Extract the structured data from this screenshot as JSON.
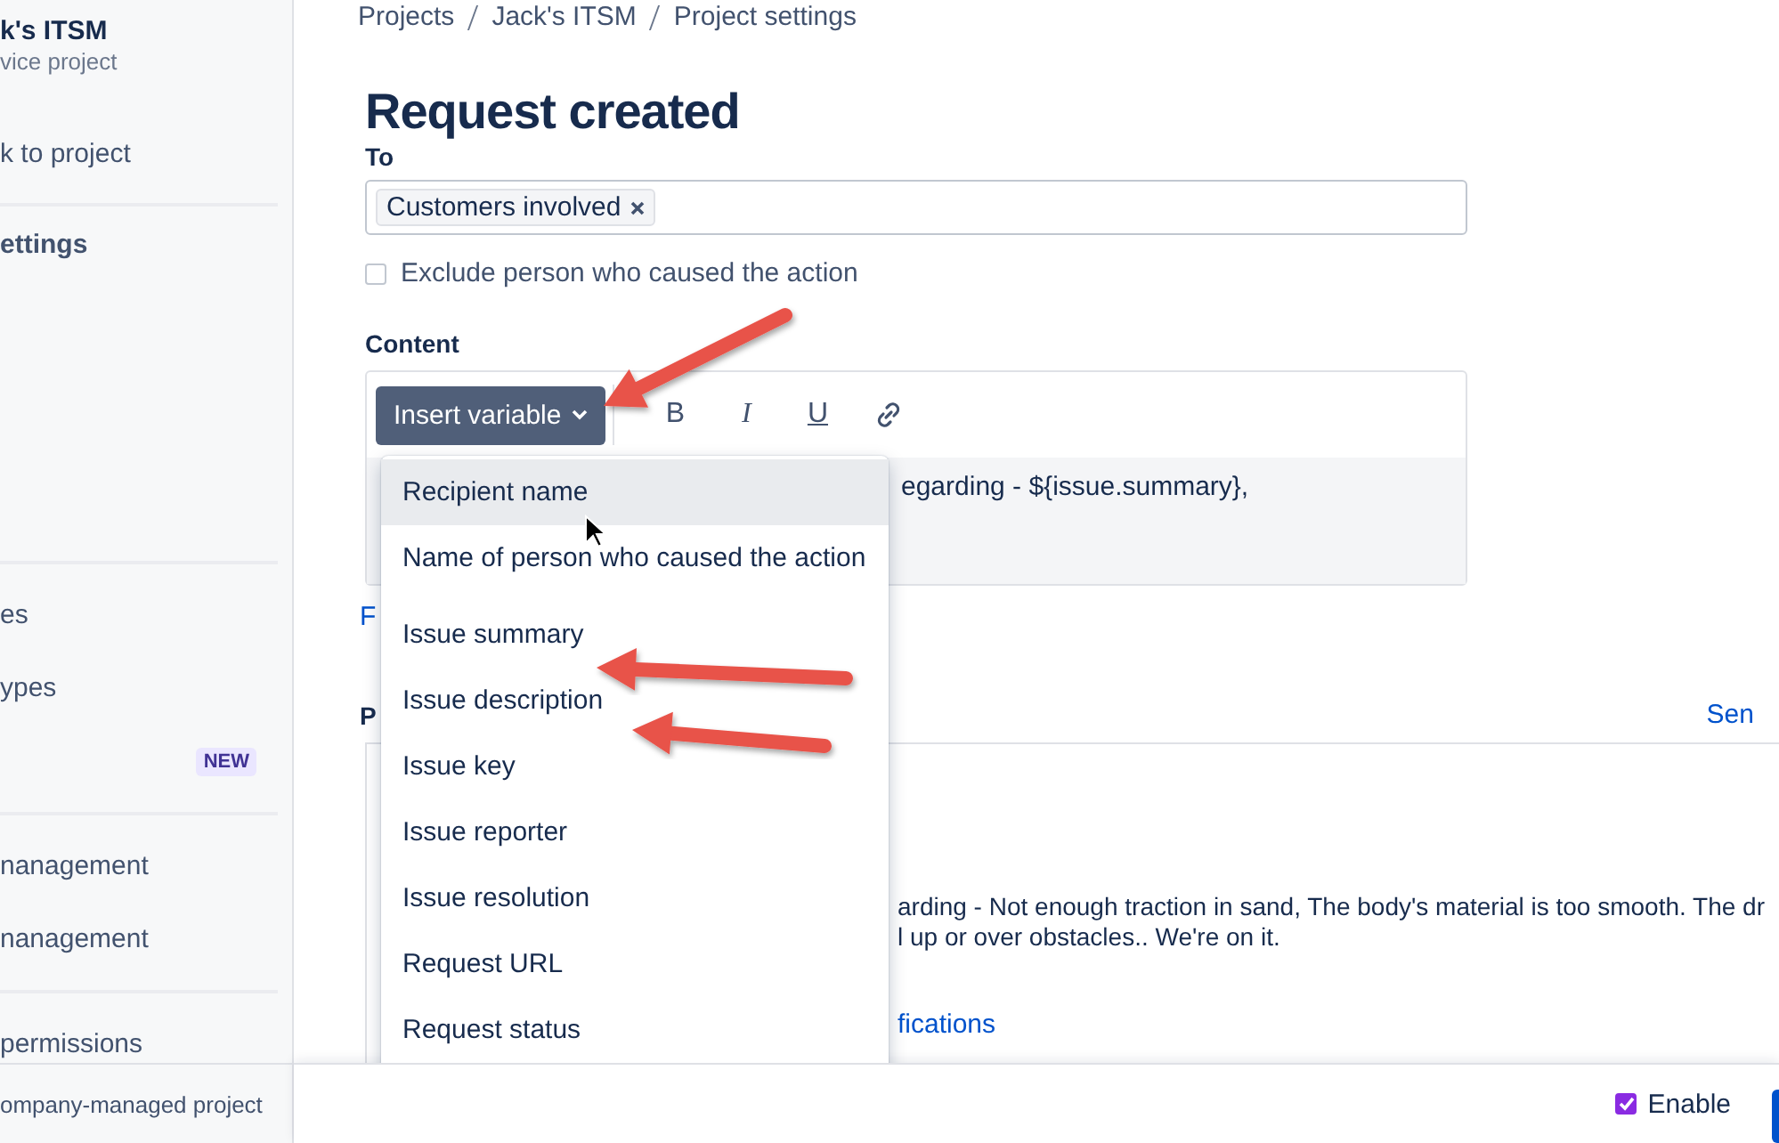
{
  "sidebar": {
    "project_name": "k's ITSM",
    "project_type": "vice project",
    "back_link": "k to project",
    "section_title": "ettings",
    "groups": [
      [
        {
          "label": "es"
        },
        {
          "label": "ypes"
        },
        {
          "badge": "NEW"
        }
      ],
      [
        {
          "label": "nanagement"
        },
        {
          "label": "nanagement"
        }
      ],
      [
        {
          "label": "permissions"
        }
      ]
    ],
    "footer": "ompany-managed project"
  },
  "breadcrumbs": [
    "Projects",
    "Jack's ITSM",
    "Project settings"
  ],
  "title": "Request created",
  "to": {
    "label": "To",
    "chips": [
      "Customers involved"
    ]
  },
  "exclude": {
    "label": "Exclude person who caused the action",
    "checked": false
  },
  "content": {
    "label": "Content",
    "insert_button": "Insert variable",
    "format_buttons": [
      {
        "kind": "bold",
        "text": "B"
      },
      {
        "kind": "italic",
        "text": "I"
      },
      {
        "kind": "underline",
        "text": "U"
      },
      {
        "kind": "link"
      }
    ],
    "body_text": "egarding - ${issue.summary},",
    "below_link": "F"
  },
  "menu": {
    "groups": [
      [
        {
          "label": "Recipient name",
          "selected": true
        },
        {
          "label": "Name of person who caused the action",
          "selected": false
        }
      ],
      [
        {
          "label": "Issue summary",
          "selected": false
        },
        {
          "label": "Issue description",
          "selected": false
        },
        {
          "label": "Issue key",
          "selected": false
        },
        {
          "label": "Issue reporter",
          "selected": false
        },
        {
          "label": "Issue resolution",
          "selected": false
        },
        {
          "label": "Request URL",
          "selected": false
        },
        {
          "label": "Request status",
          "selected": false
        }
      ]
    ]
  },
  "preview": {
    "label": "P",
    "send_link": "Sen",
    "lines": [
      "arding - Not enough traction in sand, The body's material is too smooth. The dr",
      "l up or over obstacles.. We're on it."
    ],
    "link": "fications"
  },
  "footer_bar": {
    "enable": {
      "label": "Enable",
      "checked": true
    }
  }
}
